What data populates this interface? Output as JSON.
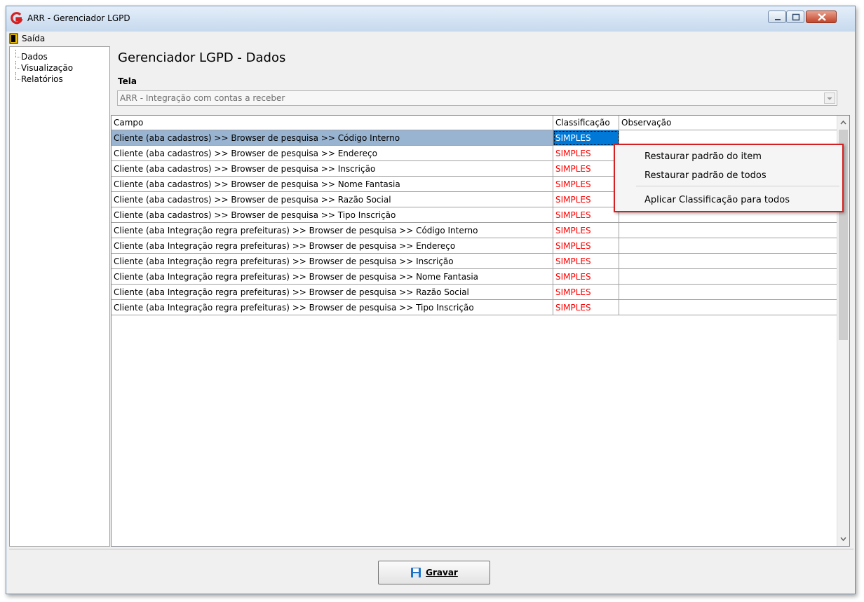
{
  "window": {
    "title": "ARR - Gerenciador LGPD"
  },
  "menu": {
    "exit_label": "Saída"
  },
  "sidebar": {
    "items": [
      {
        "label": "Dados"
      },
      {
        "label": "Visualização"
      },
      {
        "label": "Relatórios"
      }
    ]
  },
  "page": {
    "title": "Gerenciador LGPD - Dados",
    "tela_label": "Tela"
  },
  "combo": {
    "value": "ARR - Integração com contas a receber"
  },
  "grid": {
    "columns": {
      "campo": "Campo",
      "classificacao": "Classificação",
      "observacao": "Observação"
    },
    "rows": [
      {
        "campo": "Cliente (aba cadastros) >> Browser de pesquisa >> Código Interno",
        "classificacao": "SIMPLES",
        "observacao": ""
      },
      {
        "campo": "Cliente (aba cadastros) >> Browser de pesquisa >> Endereço",
        "classificacao": "SIMPLES",
        "observacao": ""
      },
      {
        "campo": "Cliente (aba cadastros) >> Browser de pesquisa >> Inscrição",
        "classificacao": "SIMPLES",
        "observacao": ""
      },
      {
        "campo": "Cliente (aba cadastros) >> Browser de pesquisa >> Nome Fantasia",
        "classificacao": "SIMPLES",
        "observacao": ""
      },
      {
        "campo": "Cliente (aba cadastros) >> Browser de pesquisa >> Razão Social",
        "classificacao": "SIMPLES",
        "observacao": ""
      },
      {
        "campo": "Cliente (aba cadastros) >> Browser de pesquisa >> Tipo Inscrição",
        "classificacao": "SIMPLES",
        "observacao": ""
      },
      {
        "campo": "Cliente (aba Integração regra prefeituras) >> Browser de pesquisa >> Código Interno",
        "classificacao": "SIMPLES",
        "observacao": ""
      },
      {
        "campo": "Cliente (aba Integração regra prefeituras) >> Browser de pesquisa >> Endereço",
        "classificacao": "SIMPLES",
        "observacao": ""
      },
      {
        "campo": "Cliente (aba Integração regra prefeituras) >> Browser de pesquisa >> Inscrição",
        "classificacao": "SIMPLES",
        "observacao": ""
      },
      {
        "campo": "Cliente (aba Integração regra prefeituras) >> Browser de pesquisa >> Nome Fantasia",
        "classificacao": "SIMPLES",
        "observacao": ""
      },
      {
        "campo": "Cliente (aba Integração regra prefeituras) >> Browser de pesquisa >> Razão Social",
        "classificacao": "SIMPLES",
        "observacao": ""
      },
      {
        "campo": "Cliente (aba Integração regra prefeituras) >> Browser de pesquisa >> Tipo Inscrição",
        "classificacao": "SIMPLES",
        "observacao": ""
      }
    ]
  },
  "context_menu": {
    "items": [
      {
        "label": "Restaurar padrão do item"
      },
      {
        "label": "Restaurar padrão de todos"
      },
      {
        "label": "Aplicar Classificação para todos"
      }
    ]
  },
  "footer": {
    "save_label": "Gravar"
  },
  "colors": {
    "accent_red": "#ff0000",
    "selection": "#0078d7",
    "highlight_border": "#d42020"
  },
  "icons": {
    "app": "arr-logo-icon",
    "exit": "exit-door-icon",
    "save": "floppy-disk-icon"
  }
}
